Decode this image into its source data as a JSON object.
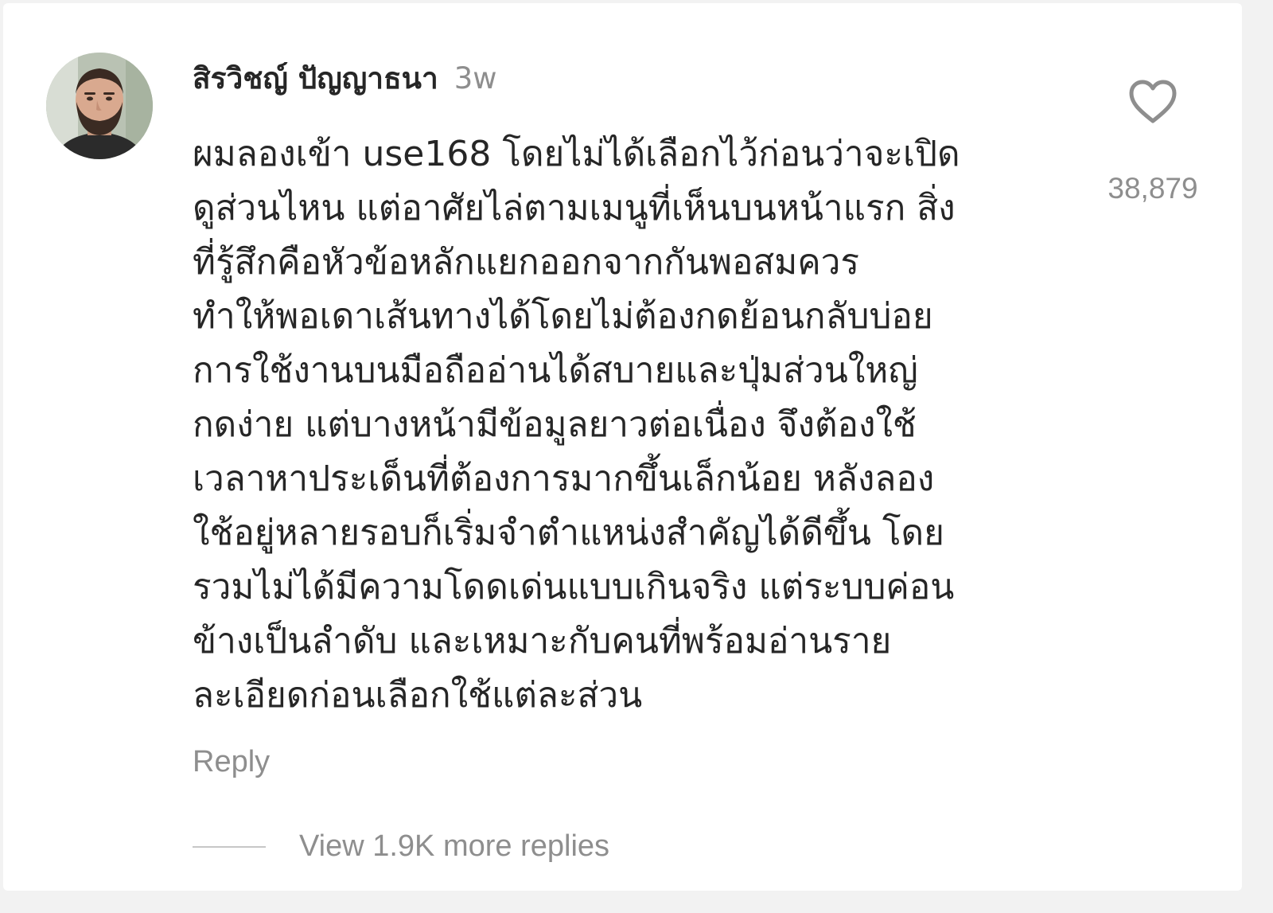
{
  "comment": {
    "username": "สิรวิชญ์ ปัญญาธนา",
    "timestamp": "3w",
    "text": "ผมลองเข้า use168 โดยไม่ได้เลือกไว้ก่อนว่าจะเปิด\nดูส่วนไหน แต่อาศัยไล่ตามเมนูที่เห็นบนหน้าแรก สิ่ง\nที่รู้สึกคือหัวข้อหลักแยกออกจากกันพอสมควร\nทำให้พอเดาเส้นทางได้โดยไม่ต้องกดย้อนกลับบ่อย\nการใช้งานบนมือถืออ่านได้สบายและปุ่มส่วนใหญ่\nกดง่าย แต่บางหน้ามีข้อมูลยาวต่อเนื่อง จึงต้องใช้\nเวลาหาประเด็นที่ต้องการมากขึ้นเล็กน้อย หลังลอง\nใช้อยู่หลายรอบก็เริ่มจำตำแหน่งสำคัญได้ดีขึ้น โดย\nรวมไม่ได้มีความโดดเด่นแบบเกินจริง แต่ระบบค่อน\nข้างเป็นลำดับ และเหมาะกับคนที่พร้อมอ่านราย\nละเอียดก่อนเลือกใช้แต่ละส่วน",
    "reply_label": "Reply",
    "view_replies_label": "View 1.9K more replies",
    "like_count": "38,879",
    "like_icon": "heart-outline-icon"
  },
  "colors": {
    "primary_text": "#262626",
    "secondary_text": "#8e8e8e",
    "divider": "#c7c7c7",
    "background": "#ffffff"
  }
}
